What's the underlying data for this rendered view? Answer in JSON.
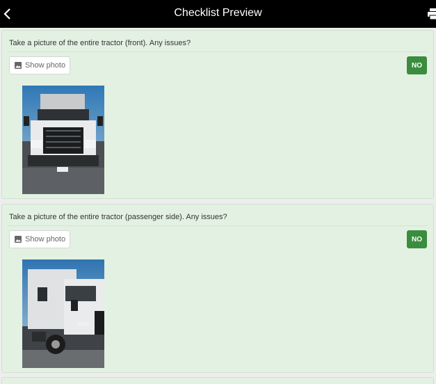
{
  "header": {
    "title": "Checklist Preview",
    "back_icon": "chevron-left-icon",
    "print_icon": "printer-icon"
  },
  "colors": {
    "header_bg": "#000000",
    "card_bg": "#e3f1e2",
    "answer_bg": "#3a8d3e"
  },
  "items": [
    {
      "question": "Take a picture of the entire tractor (front). Any issues?",
      "photo_label": "Show photo",
      "answer": "NO"
    },
    {
      "question": "Take a picture of the entire tractor (passenger side). Any issues?",
      "photo_label": "Show photo",
      "answer": "NO"
    }
  ]
}
